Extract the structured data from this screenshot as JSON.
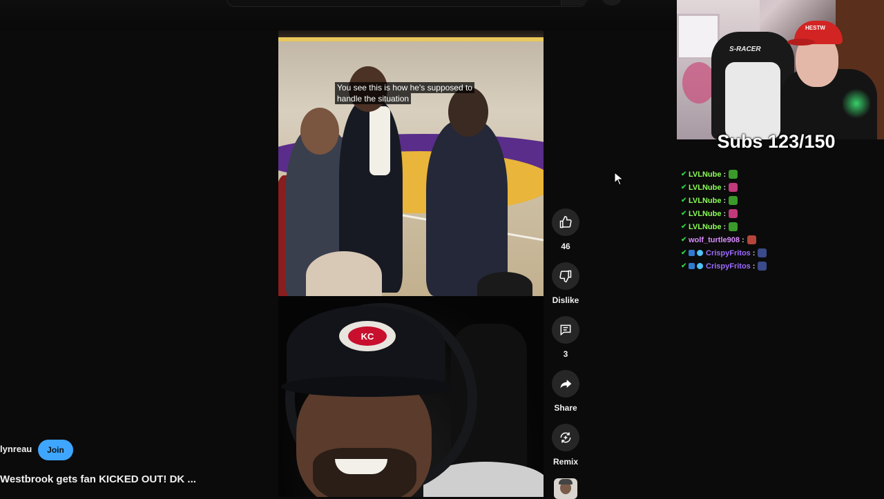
{
  "video": {
    "caption": "You see this is how he's supposed to handle the situation",
    "hat_logo_text": "KC"
  },
  "actions": {
    "like": {
      "icon": "thumbs-up-icon",
      "label": "46"
    },
    "dislike": {
      "icon": "thumbs-down-icon",
      "label": "Dislike"
    },
    "comments": {
      "icon": "comment-icon",
      "label": "3"
    },
    "share": {
      "icon": "share-icon",
      "label": "Share"
    },
    "remix": {
      "icon": "remix-icon",
      "label": "Remix"
    }
  },
  "channel": {
    "name": "lynreau",
    "join_label": "Join"
  },
  "short": {
    "title": "Westbrook gets fan KICKED OUT! DK ..."
  },
  "overlay": {
    "subs_goal": "Subs 123/150",
    "webcam_chair_brand": "S-RACER",
    "cap_text": "HESTW"
  },
  "chat": [
    {
      "user": "LVLNube",
      "color": "#8aff57",
      "sep": ":",
      "emote": "leaf",
      "emote_color": "#3a9a2a",
      "badges": 1
    },
    {
      "user": "LVLNube",
      "color": "#8aff57",
      "sep": ":",
      "emote": "love",
      "emote_color": "#c0397a",
      "badges": 1
    },
    {
      "user": "LVLNube",
      "color": "#8aff57",
      "sep": ":",
      "emote": "leaf",
      "emote_color": "#3a9a2a",
      "badges": 1
    },
    {
      "user": "LVLNube",
      "color": "#8aff57",
      "sep": ":",
      "emote": "love",
      "emote_color": "#c0397a",
      "badges": 1
    },
    {
      "user": "LVLNube",
      "color": "#8aff57",
      "sep": ":",
      "emote": "leaf",
      "emote_color": "#3a9a2a",
      "badges": 1
    },
    {
      "user": "wolf_turtle908",
      "color": "#d98cff",
      "sep": ":",
      "emote": "sticker",
      "emote_color": "#b5443a",
      "badges": 1
    },
    {
      "user": "CrispyFritos",
      "color": "#9d6bff",
      "sep": ":",
      "emote": "gem",
      "emote_color": "#3a4a8a",
      "badges": 3
    },
    {
      "user": "CrispyFritos",
      "color": "#9d6bff",
      "sep": ":",
      "emote": "gem",
      "emote_color": "#3a4a8a",
      "badges": 3
    }
  ],
  "colors": {
    "join_button": "#3ea6ff",
    "action_circle": "#262626",
    "page_bg": "#0b0b0b"
  }
}
